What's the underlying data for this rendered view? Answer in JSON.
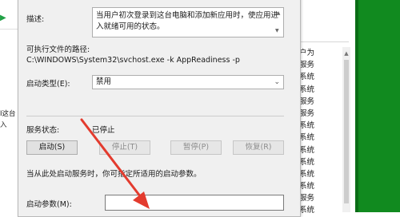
{
  "colors": {
    "accent_arrow": "#e33b2e",
    "desktop_green": "#118a1f",
    "dialog_bg": "#f0f0f0",
    "play_green": "#21a146"
  },
  "background_left": {
    "play_icon": "play-icon",
    "text_1": "I这台",
    "text_2": "入"
  },
  "background_list": {
    "items": [
      "户为",
      "服务",
      "系统",
      "系统",
      "服务",
      "服务",
      "系统",
      "系统",
      "系统",
      "系统",
      "系统",
      "系统",
      "服务",
      "系统"
    ]
  },
  "dialog": {
    "description_label": "描述:",
    "description_text": "当用户初次登录到这台电脑和添加新应用时，使应用进入就绪可用的状态。",
    "exe_path_label": "可执行文件的路径:",
    "exe_path_value": "C:\\WINDOWS\\System32\\svchost.exe -k AppReadiness -p",
    "startup_type_label": "启动类型(E):",
    "startup_type_value": "禁用",
    "service_status_label": "服务状态:",
    "service_status_value": "已停止",
    "buttons": {
      "start": "启动(S)",
      "stop": "停止(T)",
      "pause": "暂停(P)",
      "resume": "恢复(R)"
    },
    "hint_text": "当从此处启动服务时，你可指定所适用的启动参数。",
    "start_params_label": "启动参数(M):",
    "start_params_value": ""
  }
}
